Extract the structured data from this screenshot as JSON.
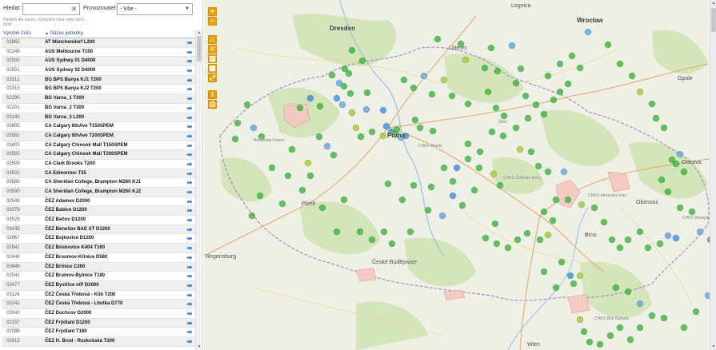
{
  "filters": {
    "search_label": "Hledat:",
    "search_value": "",
    "clear_glyph": "✕",
    "operator_label": "Provozovatel:",
    "operator_selected": "- Vše -",
    "dropdown_glyph": "▼"
  },
  "hint": "Hledání dle názvu, výrobního čísla nebo jejich části",
  "table": {
    "col_code": "Výrobní číslo",
    "col_name": "Název jednotky",
    "sort_glyph": "▲",
    "go_glyph": "➡",
    "rows": [
      {
        "code": "02862",
        "name": "AT Münchendorf L200"
      },
      {
        "code": "02249",
        "name": "AUS Melbourne T100"
      },
      {
        "code": "02550",
        "name": "AUS Sydney 01 D4000"
      },
      {
        "code": "02551",
        "name": "AUS Sydney 02 D4000"
      },
      {
        "code": "03312",
        "name": "BG BPS Banya KJ1 T200"
      },
      {
        "code": "03313",
        "name": "BG BPS Banya KJ2 T200"
      },
      {
        "code": "02290",
        "name": "BG Varna_1 T300"
      },
      {
        "code": "02201",
        "name": "BG Varna_2 T300"
      },
      {
        "code": "03140",
        "name": "BG Varna_3 L300"
      },
      {
        "code": "03605",
        "name": "CA Calgary 8thAve T150SPEM"
      },
      {
        "code": "03582",
        "name": "CA Calgary 8thAve T200SPEM"
      },
      {
        "code": "03403",
        "name": "CA Calgary Chinook Mall T150SPEM"
      },
      {
        "code": "03583",
        "name": "CA Calgary Chinook Mall T200SPEM"
      },
      {
        "code": "03509",
        "name": "CA Clark Brooks T200"
      },
      {
        "code": "03532",
        "name": "CA Edmonton T35"
      },
      {
        "code": "03589",
        "name": "CA Sheridan College, Brampton M260 KJ1"
      },
      {
        "code": "03590",
        "name": "CA Sheridan College, Brampton M260 KJ2"
      },
      {
        "code": "02548",
        "name": "ČEZ Adamov D2000"
      },
      {
        "code": "03379",
        "name": "ČEZ Babice D1200"
      },
      {
        "code": "03529",
        "name": "ČEZ Bečov D1200"
      },
      {
        "code": "03435",
        "name": "ČEZ Benešov BAE ST D1200"
      },
      {
        "code": "02967",
        "name": "ČEZ Bojkovice D1200"
      },
      {
        "code": "02541",
        "name": "ČEZ Boskovice K404 T160"
      },
      {
        "code": "02448",
        "name": "ČEZ Broumov-Křinice D580"
      },
      {
        "code": "00649",
        "name": "ČEZ Brtnice C260"
      },
      {
        "code": "02542",
        "name": "ČEZ Brumov-Bylnice T180"
      },
      {
        "code": "02477",
        "name": "ČEZ Bystřice n/P D2000"
      },
      {
        "code": "03124",
        "name": "ČEZ Česká Třebová - Klib T200"
      },
      {
        "code": "03242",
        "name": "ČEZ Česká Třebová - Lhotka D770"
      },
      {
        "code": "03040",
        "name": "ČEZ Duchcov D2000"
      },
      {
        "code": "02157",
        "name": "ČEZ Frýdlant D1200"
      },
      {
        "code": "02088",
        "name": "ČEZ Frýdlant T180"
      },
      {
        "code": "03515",
        "name": "ČEZ H. Brod - Rozkošská T200"
      }
    ]
  },
  "scroll": {
    "up": "▲",
    "down": "▼"
  },
  "map": {
    "controls": [
      "+",
      "−"
    ],
    "labels": {
      "dresden": "Dresden",
      "wroclaw": "Wrocław",
      "praha": "Praha",
      "regensburg": "Regensburg",
      "legnica": "Legnica",
      "opole": "Opole",
      "brno": "Brno",
      "wien": "Wien",
      "liberec": "Liberec",
      "plzen": "Plzeň",
      "ceske_budejovice": "České Budějovice",
      "olomouc": "Olomouc",
      "ostrava": "Ostrava",
      "ziar": "Žďár",
      "chko_zdarske": "CHKO Žďárské vrchy",
      "chko_blanik": "CHKO Blaník",
      "chko_beskydy": "CHKO Beskydy",
      "chko_morav": "CHKO Moravský kras",
      "chko_bile": "CHKO Bílé Karpaty",
      "bohemian": "Bohemian Forest"
    },
    "colors": {
      "green": "#3cb43c",
      "yellow_green": "#a8c832",
      "blue": "#3c8ce6",
      "light_blue": "#64a0e6"
    }
  }
}
